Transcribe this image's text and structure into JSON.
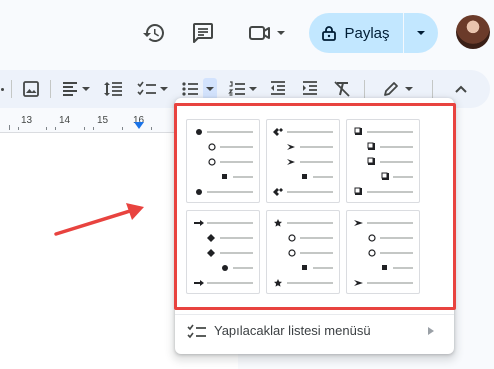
{
  "header": {
    "icons": [
      "history-icon",
      "comment-icon",
      "video-camera-icon"
    ],
    "share": {
      "label": "Paylaş",
      "icon": "lock-icon"
    }
  },
  "toolbar": {
    "icons": [
      "image-icon",
      "align-left-icon",
      "line-spacing-icon",
      "checklist-icon",
      "bulleted-list-icon",
      "numbered-list-icon",
      "decrease-indent-icon",
      "increase-indent-icon",
      "clear-formatting-icon",
      "pencil-icon",
      "chevron-up-icon"
    ]
  },
  "ruler": {
    "labels": [
      "13",
      "14",
      "15",
      "16"
    ]
  },
  "bullet_menu": {
    "presets": [
      {
        "name": "filled-circle-hollow-circle-square",
        "glyphs": [
          "●",
          "○",
          "■"
        ]
      },
      {
        "name": "diamond-arrowhead-square",
        "glyphs": [
          "❖",
          "➢",
          "■"
        ]
      },
      {
        "name": "shadowed-square",
        "glyphs": [
          "❑"
        ]
      },
      {
        "name": "arrow-diamond-circle",
        "glyphs": [
          "➔",
          "◆",
          "●"
        ]
      },
      {
        "name": "star-circle-square",
        "glyphs": [
          "★",
          "○",
          "■"
        ]
      },
      {
        "name": "arrowhead-circle-square",
        "glyphs": [
          "➢",
          "○",
          "■"
        ]
      }
    ],
    "checklist_item": {
      "label": "Yapılacaklar listesi menüsü",
      "icon": "checklist-icon"
    }
  },
  "colors": {
    "accent": "#1a73e8",
    "share_bg": "#c2e7ff",
    "toolbar_bg": "#edf2fa",
    "highlight": "#e8433f"
  }
}
